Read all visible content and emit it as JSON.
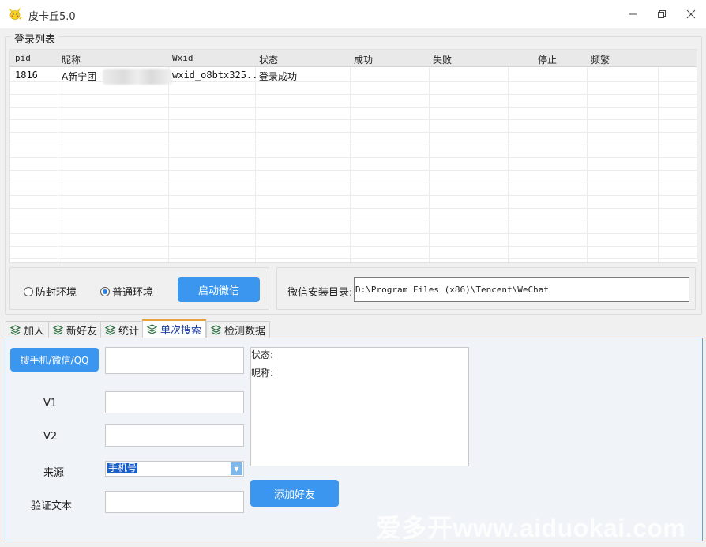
{
  "window": {
    "title": "皮卡丘5.0"
  },
  "login_list": {
    "title": "登录列表",
    "columns": [
      "pid",
      "昵称",
      "Wxid",
      "状态",
      "成功",
      "失败",
      "停止",
      "频繁"
    ],
    "rows": [
      {
        "pid": "1816",
        "nickname": "A新宁团",
        "wxid": "wxid_o8btx325...",
        "status": "登录成功",
        "success": "",
        "fail": "",
        "stop": "",
        "frequent": ""
      }
    ]
  },
  "environment": {
    "options": [
      "防封环境",
      "普通环境"
    ],
    "selected": "普通环境",
    "launch_button": "启动微信"
  },
  "install": {
    "label": "微信安装目录:",
    "path": "D:\\Program Files (x86)\\Tencent\\WeChat"
  },
  "tabs": [
    {
      "label": "加人",
      "active": false
    },
    {
      "label": "新好友",
      "active": false
    },
    {
      "label": "统计",
      "active": false
    },
    {
      "label": "单次搜索",
      "active": true
    },
    {
      "label": "检测数据",
      "active": false
    }
  ],
  "search_tab": {
    "search_button": "搜手机/微信/QQ",
    "search_value": "",
    "v1_label": "V1",
    "v1_value": "",
    "v2_label": "V2",
    "v2_value": "",
    "source_label": "来源",
    "source_selected": "手机号",
    "verify_label": "验证文本",
    "verify_value": "",
    "status_label": "状态:",
    "nickname_label": "昵称:",
    "add_button": "添加好友"
  },
  "watermark": "爱多开www.aiduokai.com",
  "colors": {
    "accent_button": "#3a96ee",
    "active_tab_top": "#e6a23c",
    "selection": "#1b5fc9"
  },
  "icons": {
    "app": "pikachu-icon",
    "tab": "layers-icon"
  }
}
